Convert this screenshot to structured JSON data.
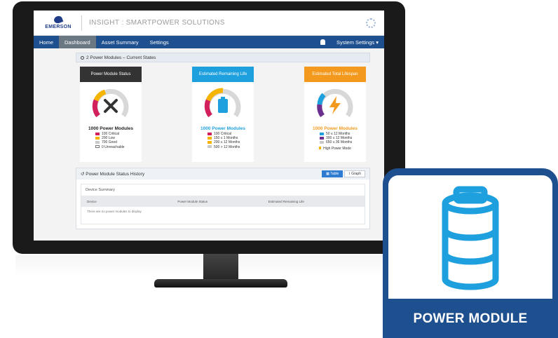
{
  "app": {
    "logo_text": "EMERSON",
    "title": "INSIGHT : SMARTPOWER SOLUTIONS"
  },
  "nav": {
    "items": [
      {
        "label": "Home",
        "active": false
      },
      {
        "label": "Dashboard",
        "active": true
      },
      {
        "label": "Asset Summary",
        "active": false
      },
      {
        "label": "Settings",
        "active": false
      }
    ],
    "system_settings": "System Settings"
  },
  "states_panel": {
    "title": "2 Power Modules – Current States"
  },
  "cards": [
    {
      "header": "Power Module Status",
      "header_color": "#333333",
      "count": "1000 Power Modules",
      "count_color": "#222222",
      "icon": "wrench-screwdriver-icon",
      "legend": [
        {
          "color": "#d21f5e",
          "value": "100",
          "label": "Critical"
        },
        {
          "color": "#f5b400",
          "value": "200",
          "label": "Low"
        },
        {
          "color": "#c9c9c9",
          "value": "700",
          "label": "Good"
        },
        {
          "color": "#ffffff",
          "value": "0",
          "label": "Unreachable"
        }
      ]
    },
    {
      "header": "Estimated Remaining Life",
      "header_color": "#1fa0de",
      "count": "1000 Power Modules",
      "count_color": "#1fa0de",
      "icon": "battery-icon",
      "legend": [
        {
          "color": "#d21f5e",
          "value": "100",
          "label": "Critical"
        },
        {
          "color": "#f5b400",
          "value": "150",
          "label": "≤ 1 Months"
        },
        {
          "color": "#f5b400",
          "value": "200",
          "label": "≤ 12 Months"
        },
        {
          "color": "#c9c9c9",
          "value": "500",
          "label": "> 12 Months"
        }
      ]
    },
    {
      "header": "Estimated Total Lifespan",
      "header_color": "#f39a1e",
      "count": "1000 Power Modules",
      "count_color": "#f39a1e",
      "icon": "lightning-icon",
      "legend": [
        {
          "color": "#1fa0de",
          "value": "50",
          "label": "≤ 12 Months"
        },
        {
          "color": "#6b2f8f",
          "value": "300",
          "label": "≤ 12 Months"
        },
        {
          "color": "#c9c9c9",
          "value": "650",
          "label": "≤ 36 Months"
        }
      ],
      "footer": "High Power Mode"
    }
  ],
  "history": {
    "title": "Power Module Status History",
    "table_button": "Table",
    "graph_button": "Graph",
    "device_summary": "Device Summary",
    "columns": [
      "Device",
      "Power Module Status",
      "Estimated Remaining Life"
    ],
    "empty_message": "There are no power modules to display"
  },
  "badge": {
    "label": "POWER MODULE",
    "icon": "battery-icon"
  },
  "colors": {
    "brand_blue": "#1e4f8f",
    "critical": "#d21f5e",
    "warning": "#f5b400",
    "accent_blue": "#1fa0de",
    "accent_orange": "#f39a1e",
    "purple": "#6b2f8f"
  }
}
